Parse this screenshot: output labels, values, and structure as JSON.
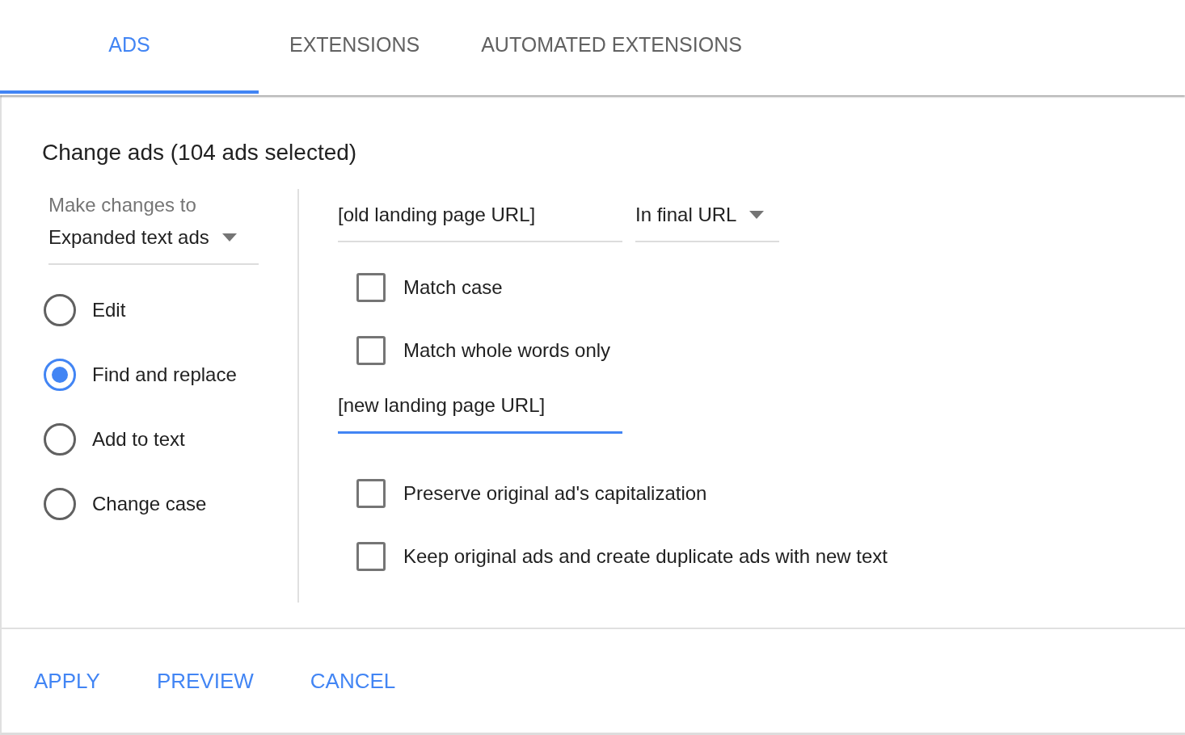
{
  "tabs": [
    {
      "label": "ADS",
      "selected": true
    },
    {
      "label": "EXTENSIONS",
      "selected": false
    },
    {
      "label": "AUTOMATED EXTENSIONS",
      "selected": false
    }
  ],
  "title": "Change ads (104 ads selected)",
  "scope": {
    "label": "Make changes to",
    "value": "Expanded text ads"
  },
  "modes": [
    {
      "label": "Edit",
      "selected": false
    },
    {
      "label": "Find and replace",
      "selected": true
    },
    {
      "label": "Add to text",
      "selected": false
    },
    {
      "label": "Change case",
      "selected": false
    }
  ],
  "find": {
    "value": "[old landing page URL]",
    "focused": false
  },
  "location": {
    "value": "In final URL"
  },
  "find_options": [
    {
      "label": "Match case",
      "checked": false
    },
    {
      "label": "Match whole words only",
      "checked": false
    }
  ],
  "replace": {
    "value": "[new landing page URL]",
    "focused": true
  },
  "replace_options": [
    {
      "label": "Preserve original ad's capitalization",
      "checked": false
    },
    {
      "label": "Keep original ads and create duplicate ads with new text",
      "checked": false
    }
  ],
  "actions": [
    "APPLY",
    "PREVIEW",
    "CANCEL"
  ]
}
